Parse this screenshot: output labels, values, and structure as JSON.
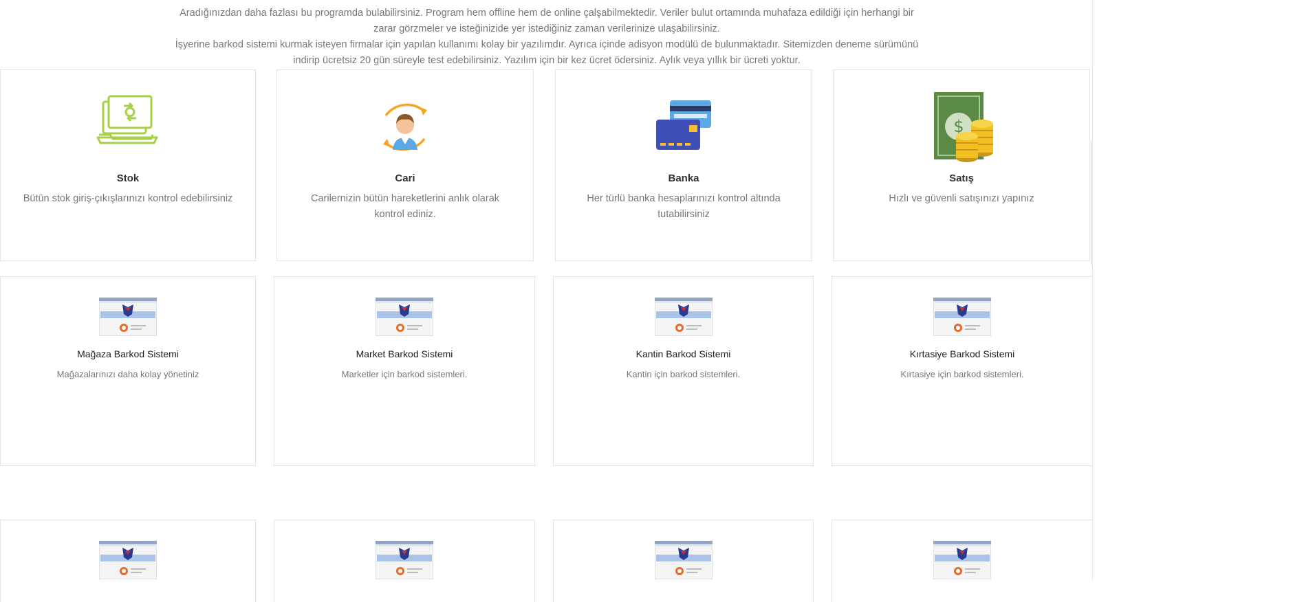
{
  "intro": {
    "line1": "Aradığınızdan daha fazlası bu programda bulabilirsiniz. Program hem offline hem de online çalşabilmektedir. Veriler bulut ortamında muhafaza edildiği için herhangi bir",
    "line2": "zarar görzmeler ve isteğinizide yer istediğiniz zaman verilerinize ulaşabilirsiniz.",
    "line3": "İşyerine barkod sistemi kurmak isteyen firmalar için yapılan kullanımı kolay bir yazılımdır. Ayrıca içinde adisyon modülü de bulunmaktadır. Sitemizden deneme sürümünü",
    "line4": "indirip ücretsiz 20 gün süreyle test edebilirsiniz. Yazılım için bir kez ücret ödersiniz. Aylık veya yıllık bir ücreti yoktur."
  },
  "features": [
    {
      "title": "Stok",
      "desc": "Bütün stok giriş-çıkışlarınızı kontrol edebilirsiniz",
      "icon": "laptop-exchange-icon"
    },
    {
      "title": "Cari",
      "desc": "Carilernizin bütün hareketlerini anlık olarak kontrol ediniz.",
      "icon": "person-cycle-icon"
    },
    {
      "title": "Banka",
      "desc": "Her türlü banka hesaplarınızı kontrol altında tutabilirsiniz",
      "icon": "credit-card-icon"
    },
    {
      "title": "Satış",
      "desc": "Hızlı ve güvenli satışınızı yapınız",
      "icon": "money-coins-icon"
    }
  ],
  "products": [
    {
      "title": "Mağaza Barkod Sistemi",
      "desc": "Mağazalarınızı daha kolay yönetiniz"
    },
    {
      "title": "Market Barkod Sistemi",
      "desc": "Marketler için barkod sistemleri."
    },
    {
      "title": "Kantin Barkod Sistemi",
      "desc": "Kantin için barkod sistemleri."
    },
    {
      "title": "Kırtasiye Barkod Sistemi",
      "desc": "Kırtasiye için barkod sistemleri."
    }
  ],
  "colors": {
    "stok_icon": "#a6cf4a",
    "cari_icon": "#f5a623",
    "banka_card": "#3f4fb5",
    "satis_coin": "#f0c020",
    "satis_note": "#5b8a45"
  }
}
